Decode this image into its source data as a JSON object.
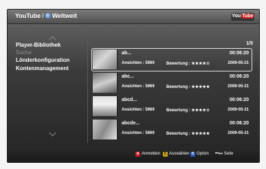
{
  "header": {
    "app_name": "YouTube",
    "separator": "/",
    "region": "Weltweit",
    "logo_text": "You",
    "logo_highlight": "Tube"
  },
  "sidebar": {
    "items": [
      {
        "label": "Player-Bibliothek",
        "state": "normal"
      },
      {
        "label": "Suche",
        "state": "dim"
      },
      {
        "label": "Lönderkonfiguration",
        "state": "normal"
      },
      {
        "label": "Kontenmanagement",
        "state": "normal"
      }
    ]
  },
  "list": {
    "page_indicator": "1/5",
    "videos": [
      {
        "title": "ab...",
        "duration": "00:06:20",
        "views": "Ansichten : 5969",
        "rating_label": "Bewertung :",
        "rating_stars": "★★★★",
        "rating_empty": "☆",
        "date": "2009-05-21",
        "selected": true
      },
      {
        "title": "abc...",
        "duration": "00:06:20",
        "views": "Ansichten : 5969",
        "rating_label": "Bewertung :",
        "rating_stars": "★★★★★",
        "rating_empty": "",
        "date": "2009-05-21",
        "selected": false
      },
      {
        "title": "abcd...",
        "duration": "00:06:20",
        "views": "Ansichten : 5969",
        "rating_label": "Bewertung :",
        "rating_stars": "★★★★",
        "rating_empty": "☆",
        "date": "2009-05-21",
        "selected": false
      },
      {
        "title": "abcde...",
        "duration": "00:06:20",
        "views": "Ansichten : 5969",
        "rating_label": "Bewertung :",
        "rating_stars": "★★★★★",
        "rating_empty": "",
        "date": "2009-05-21",
        "selected": false
      }
    ]
  },
  "footer": {
    "hints": [
      {
        "key": "A",
        "color": "red",
        "label": "Anmelden"
      },
      {
        "key": "C",
        "color": "yellow",
        "label": "Auswählen"
      },
      {
        "key": "D",
        "color": "blue",
        "label": "Option"
      },
      {
        "key": "⏮⏭",
        "color": "none",
        "label": "Seite"
      }
    ]
  },
  "colors": {
    "key_red": "#c8202a",
    "key_yellow": "#c9a420",
    "key_blue": "#2a58b8",
    "selection_border": "#e6e6e6"
  }
}
